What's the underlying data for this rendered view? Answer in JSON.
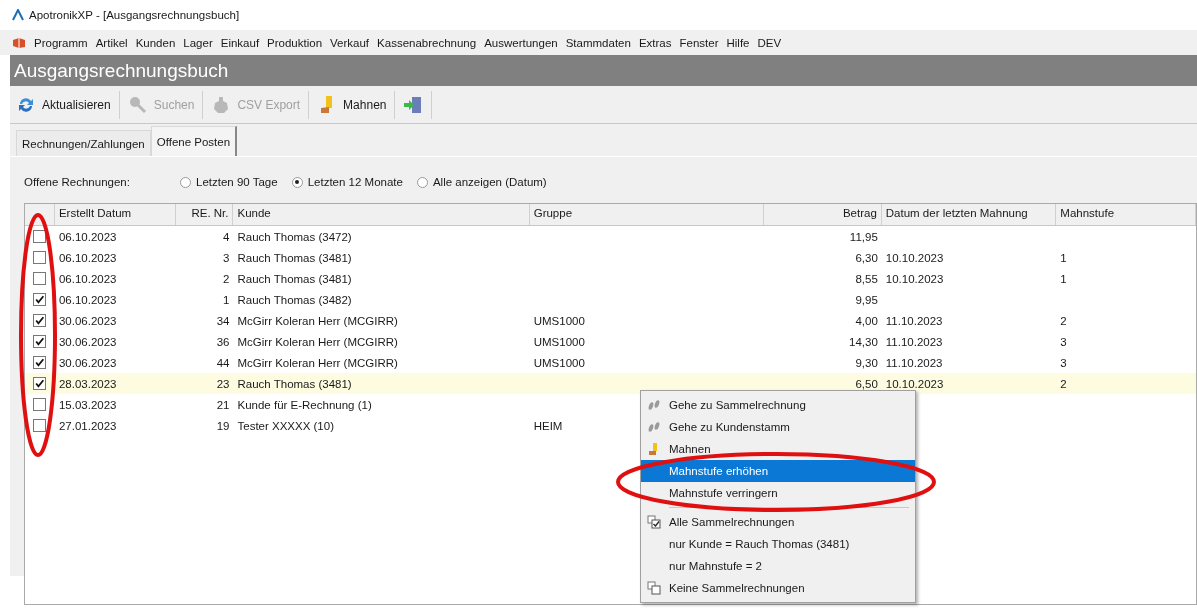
{
  "window": {
    "title": "ApotronikXP  - [Ausgangsrechnungsbuch]"
  },
  "menu": [
    "Programm",
    "Artikel",
    "Kunden",
    "Lager",
    "Einkauf",
    "Produktion",
    "Verkauf",
    "Kassenabrechnung",
    "Auswertungen",
    "Stammdaten",
    "Extras",
    "Fenster",
    "Hilfe",
    "DEV"
  ],
  "page_title": "Ausgangsrechnungsbuch",
  "toolbar": [
    {
      "kind": "refresh",
      "label": "Aktualisieren",
      "disabled": false
    },
    {
      "kind": "search",
      "label": "Suchen",
      "disabled": true
    },
    {
      "kind": "export",
      "label": "CSV Export",
      "disabled": true
    },
    {
      "kind": "remind",
      "label": "Mahnen",
      "disabled": false
    },
    {
      "kind": "exit"
    }
  ],
  "tabs": [
    {
      "label": "Rechnungen/Zahlungen",
      "selected": false
    },
    {
      "label": "Offene Posten",
      "selected": true
    }
  ],
  "filter": {
    "label": "Offene Rechnungen:",
    "options": [
      {
        "label": "Letzten 90 Tage",
        "selected": false
      },
      {
        "label": "Letzten 12 Monate",
        "selected": true
      },
      {
        "label": "Alle anzeigen (Datum)",
        "selected": false
      }
    ]
  },
  "table": {
    "columns": [
      "Erstellt Datum",
      "RE. Nr.",
      "Kunde",
      "Gruppe",
      "Betrag",
      "Datum der letzten Mahnung",
      "Mahnstufe"
    ],
    "rows": [
      {
        "checked": false,
        "selected": false,
        "cells": [
          "06.10.2023",
          "4",
          "Rauch Thomas (3472)",
          "",
          "11,95",
          "",
          ""
        ]
      },
      {
        "checked": false,
        "selected": false,
        "cells": [
          "06.10.2023",
          "3",
          "Rauch Thomas (3481)",
          "",
          "6,30",
          "10.10.2023",
          "1"
        ]
      },
      {
        "checked": false,
        "selected": false,
        "cells": [
          "06.10.2023",
          "2",
          "Rauch Thomas (3481)",
          "",
          "8,55",
          "10.10.2023",
          "1"
        ]
      },
      {
        "checked": true,
        "selected": false,
        "cells": [
          "06.10.2023",
          "1",
          "Rauch Thomas (3482)",
          "",
          "9,95",
          "",
          ""
        ]
      },
      {
        "checked": true,
        "selected": false,
        "cells": [
          "30.06.2023",
          "34",
          "McGirr Koleran Herr (MCGIRR)",
          "UMS1000",
          "4,00",
          "11.10.2023",
          "2"
        ]
      },
      {
        "checked": true,
        "selected": false,
        "cells": [
          "30.06.2023",
          "36",
          "McGirr Koleran Herr (MCGIRR)",
          "UMS1000",
          "14,30",
          "11.10.2023",
          "3"
        ]
      },
      {
        "checked": true,
        "selected": false,
        "cells": [
          "30.06.2023",
          "44",
          "McGirr Koleran Herr (MCGIRR)",
          "UMS1000",
          "9,30",
          "11.10.2023",
          "3"
        ]
      },
      {
        "checked": true,
        "selected": true,
        "cells": [
          "28.03.2023",
          "23",
          "Rauch Thomas (3481)",
          "",
          "6,50",
          "10.10.2023",
          "2"
        ]
      },
      {
        "checked": false,
        "selected": false,
        "cells": [
          "15.03.2023",
          "21",
          "Kunde für E-Rechnung (1)",
          "",
          "",
          "",
          ""
        ]
      },
      {
        "checked": false,
        "selected": false,
        "cells": [
          "27.01.2023",
          "19",
          "Tester XXXXX (10)",
          "HEIM",
          "",
          "",
          ""
        ]
      }
    ]
  },
  "context_menu": [
    {
      "kind": "footprints",
      "label": "Gehe zu Sammelrechnung",
      "selected": false
    },
    {
      "kind": "footprints",
      "label": "Gehe zu Kundenstamm",
      "selected": false
    },
    {
      "kind": "remind",
      "label": "Mahnen",
      "selected": false
    },
    {
      "kind": "plain",
      "label": "Mahnstufe erhöhen",
      "selected": true
    },
    {
      "kind": "plain",
      "label": "Mahnstufe verringern",
      "selected": false
    },
    {
      "kind": "checks",
      "label": "Alle Sammelrechnungen",
      "selected": false
    },
    {
      "kind": "sub",
      "label": "nur Kunde = Rauch Thomas (3481)",
      "selected": false
    },
    {
      "kind": "sub",
      "label": "nur Mahnstufe = 2",
      "selected": false
    },
    {
      "kind": "squares",
      "label": "Keine Sammelrechnungen",
      "selected": false
    }
  ]
}
